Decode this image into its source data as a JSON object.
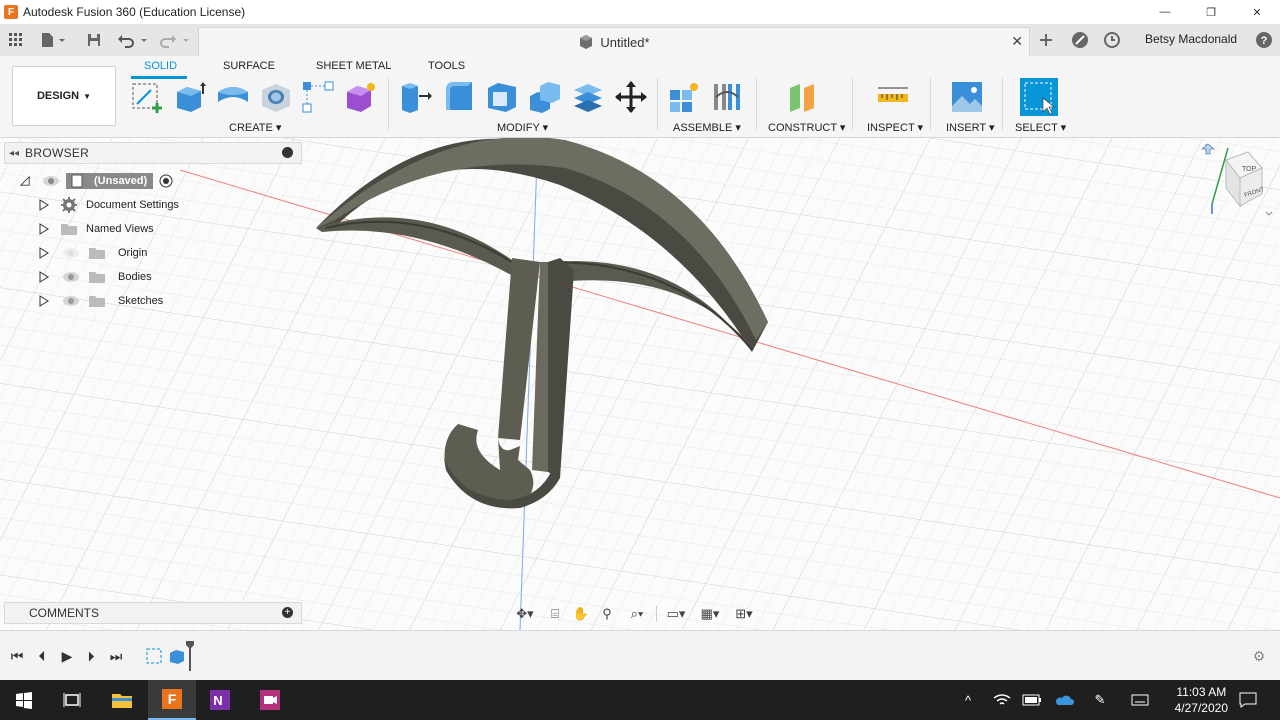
{
  "window": {
    "app_title": "Autodesk Fusion 360 (Education License)",
    "minimize": "—",
    "restore": "❐",
    "close": "✕"
  },
  "tabbar": {
    "document_title": "Untitled*",
    "user_name": "Betsy Macdonald"
  },
  "ribbon": {
    "workspace": "DESIGN",
    "tabs": [
      "SOLID",
      "SURFACE",
      "SHEET METAL",
      "TOOLS"
    ],
    "active_tab": "SOLID",
    "groups": [
      "CREATE",
      "MODIFY",
      "ASSEMBLE",
      "CONSTRUCT",
      "INSPECT",
      "INSERT",
      "SELECT"
    ]
  },
  "browser": {
    "title": "BROWSER",
    "root": "(Unsaved)",
    "items": [
      "Document Settings",
      "Named Views",
      "Origin",
      "Bodies",
      "Sketches"
    ]
  },
  "comments": {
    "title": "COMMENTS"
  },
  "viewcube": {
    "top": "TOP",
    "front": "FRONT"
  },
  "taskbar": {
    "time": "11:03 AM",
    "date": "4/27/2020"
  },
  "colors": {
    "accent": "#0696d7",
    "model": "#5f5f54",
    "brand_orange": "#e8741e"
  }
}
